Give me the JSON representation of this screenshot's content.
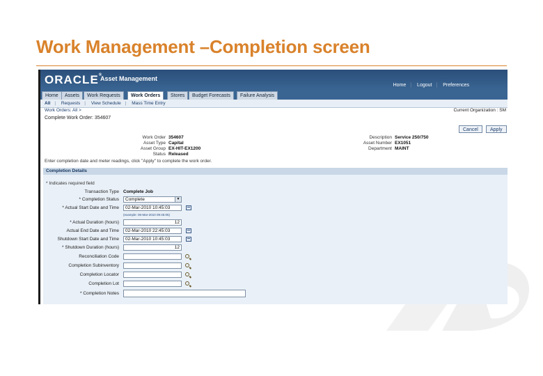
{
  "slide": {
    "title": "Work Management –Completion screen"
  },
  "app": {
    "brand": "ORACLE",
    "product": "Asset Management"
  },
  "global_links": [
    "Home",
    "Logout",
    "Preferences"
  ],
  "tabs": [
    {
      "label": "Home"
    },
    {
      "label": "Assets"
    },
    {
      "label": "Work Requests"
    },
    {
      "label": "Work Orders",
      "active": true
    },
    {
      "label": "Stores"
    },
    {
      "label": "Budget Forecasts"
    },
    {
      "label": "Failure Analysis"
    }
  ],
  "subtabs": [
    "All",
    "Requests",
    "View Schedule",
    "Mass Time Entry"
  ],
  "breadcrumb": "Work Orders: All >",
  "org_label": "Current Organization : SM",
  "page_title": "Complete Work Order: 354607",
  "buttons": {
    "cancel": "Cancel",
    "apply": "Apply"
  },
  "info_left": [
    {
      "k": "Work Order",
      "v": "354607"
    },
    {
      "k": "Asset Type",
      "v": "Capital"
    },
    {
      "k": "Asset Group",
      "v": "EX-HIT-EX1200"
    },
    {
      "k": "Status",
      "v": "Released"
    }
  ],
  "info_right": [
    {
      "k": "Description",
      "v": "Service 250/750"
    },
    {
      "k": "Asset Number",
      "v": "EX1051"
    },
    {
      "k": "Department",
      "v": "MAINT"
    }
  ],
  "instruction": "Enter completion date and meter readings, click \"Apply\" to complete the work order.",
  "section_title": "Completion Details",
  "required_note": "* Indicates required field",
  "fields": {
    "transaction_type": {
      "label": "Transaction Type",
      "value": "Complete Job"
    },
    "completion_status": {
      "label": "* Completion Status",
      "value": "Complete"
    },
    "actual_start": {
      "label": "* Actual Start Date and Time",
      "value": "02-Mar-2010 10:45:03"
    },
    "date_hint": "(example: 06-Mar-2010 09:45:05)",
    "actual_duration": {
      "label": "* Actual Duration (hours)",
      "value": "12"
    },
    "actual_end": {
      "label": "Actual End Date and Time",
      "value": "02-Mar-2010 22:45:03"
    },
    "shutdown_start": {
      "label": "Shutdown Start Date and Time",
      "value": "02-Mar-2010 10:45:03"
    },
    "shutdown_duration": {
      "label": "* Shutdown Duration (hours)",
      "value": "12"
    },
    "reconciliation_code": {
      "label": "Reconciliation Code",
      "value": ""
    },
    "completion_subinventory": {
      "label": "Completion Subinventory",
      "value": ""
    },
    "completion_locator": {
      "label": "Completion Locator",
      "value": ""
    },
    "completion_lot": {
      "label": "Completion Lot",
      "value": ""
    },
    "completion_notes": {
      "label": "* Completion Notes",
      "value": ""
    }
  },
  "colors": {
    "accent": "#d9822b",
    "header": "#2b4f7a",
    "section": "#e9f0f7"
  }
}
